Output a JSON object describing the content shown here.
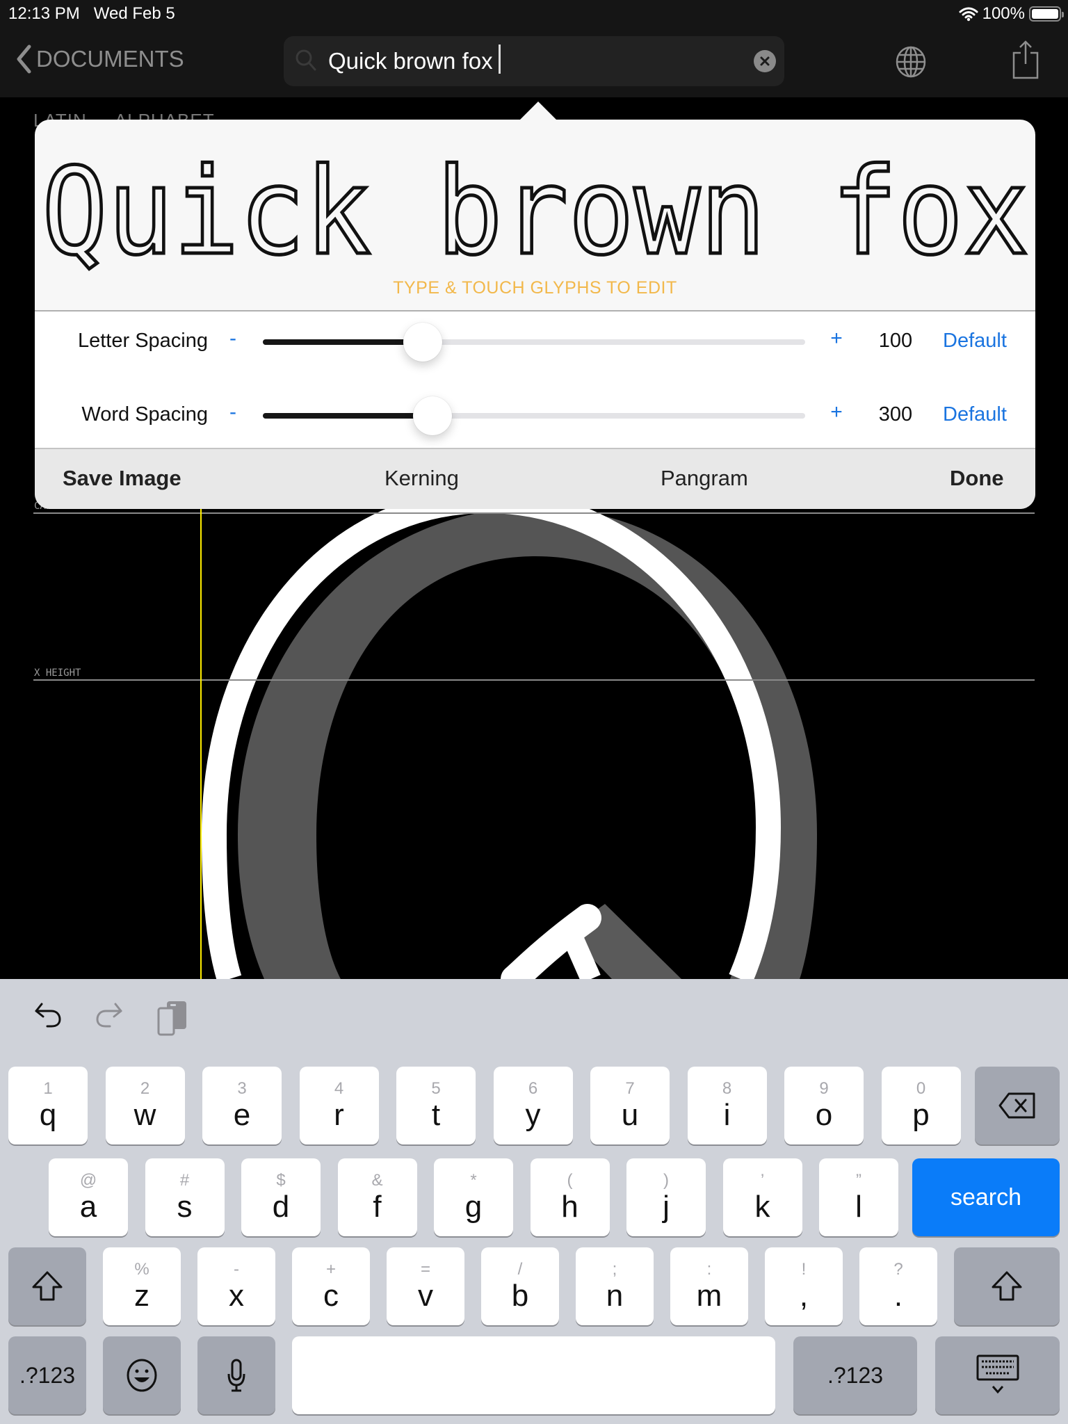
{
  "status_bar": {
    "time": "12:13 PM",
    "date": "Wed Feb 5",
    "battery_text": "100%",
    "battery_level": 1.0
  },
  "nav": {
    "back_label": "DOCUMENTS",
    "search_value": "Quick brown fox",
    "icons": [
      "chevron-left-icon",
      "search-icon",
      "clear-icon",
      "globe-icon",
      "share-icon"
    ]
  },
  "canvas": {
    "tabs": [
      "LATIN",
      "ALPHABET"
    ],
    "guides": {
      "cap_height": "CAP HEIGHT",
      "x_height": "X HEIGHT"
    },
    "glyph": "Q"
  },
  "popover": {
    "preview_text": "Quick brown fox",
    "hint": "TYPE & TOUCH GLYPHS TO EDIT",
    "hint_color": "#f2b84b",
    "sliders": [
      {
        "label": "Letter Spacing",
        "minus": "-",
        "plus": "+",
        "value": "100",
        "fraction": 0.295,
        "default_label": "Default"
      },
      {
        "label": "Word Spacing",
        "minus": "-",
        "plus": "+",
        "value": "300",
        "fraction": 0.313,
        "default_label": "Default"
      }
    ],
    "accent_color": "#1a74e0",
    "actions": {
      "save_image": "Save Image",
      "kerning": "Kerning",
      "pangram": "Pangram",
      "done": "Done"
    }
  },
  "keyboard": {
    "toolbar": [
      "undo-icon",
      "redo-icon",
      "paste-icon"
    ],
    "row1": [
      {
        "alt": "1",
        "key": "q"
      },
      {
        "alt": "2",
        "key": "w"
      },
      {
        "alt": "3",
        "key": "e"
      },
      {
        "alt": "4",
        "key": "r"
      },
      {
        "alt": "5",
        "key": "t"
      },
      {
        "alt": "6",
        "key": "y"
      },
      {
        "alt": "7",
        "key": "u"
      },
      {
        "alt": "8",
        "key": "i"
      },
      {
        "alt": "9",
        "key": "o"
      },
      {
        "alt": "0",
        "key": "p"
      }
    ],
    "row2": [
      {
        "alt": "@",
        "key": "a"
      },
      {
        "alt": "#",
        "key": "s"
      },
      {
        "alt": "$",
        "key": "d"
      },
      {
        "alt": "&",
        "key": "f"
      },
      {
        "alt": "*",
        "key": "g"
      },
      {
        "alt": "(",
        "key": "h"
      },
      {
        "alt": ")",
        "key": "j"
      },
      {
        "alt": "’",
        "key": "k"
      },
      {
        "alt": "”",
        "key": "l"
      }
    ],
    "row3": [
      {
        "alt": "%",
        "key": "z"
      },
      {
        "alt": "-",
        "key": "x"
      },
      {
        "alt": "+",
        "key": "c"
      },
      {
        "alt": "=",
        "key": "v"
      },
      {
        "alt": "/",
        "key": "b"
      },
      {
        "alt": ";",
        "key": "n"
      },
      {
        "alt": ":",
        "key": "m"
      },
      {
        "alt": "!",
        "key": ","
      },
      {
        "alt": "?",
        "key": "."
      }
    ],
    "search_label": "search",
    "numbers_label": ".?123",
    "search_color": "#0a7cf9"
  }
}
